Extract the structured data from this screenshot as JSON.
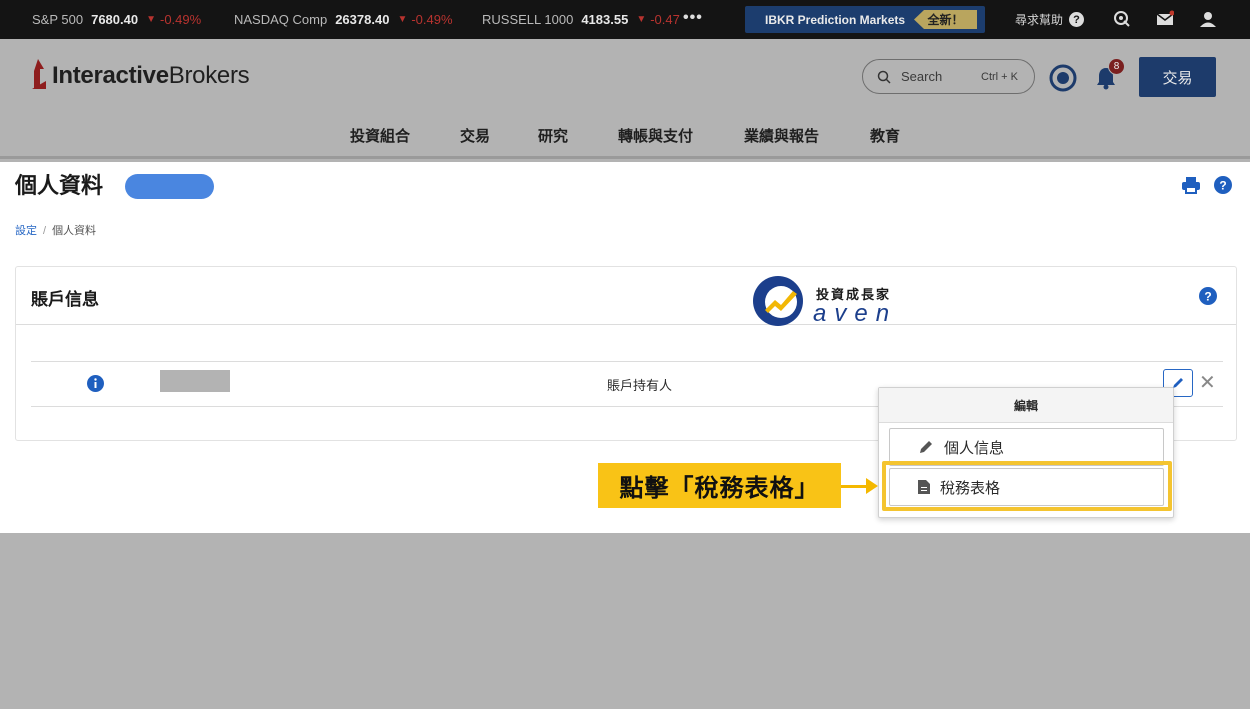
{
  "ticker": [
    {
      "name": "S&P 500",
      "value": "7680.40",
      "change": "-0.49%"
    },
    {
      "name": "NASDAQ Comp",
      "value": "26378.40",
      "change": "-0.49%"
    },
    {
      "name": "RUSSELL 1000",
      "value": "4183.55",
      "change": "-0.47"
    }
  ],
  "prediction_markets": {
    "label": "IBKR Prediction Markets",
    "badge": "全新！"
  },
  "top_links": {
    "help": "尋求幫助"
  },
  "header": {
    "brand_bold": "Interactive",
    "brand_regular": "Brokers",
    "search_placeholder": "Search",
    "search_shortcut": "Ctrl + K",
    "notification_count": "8",
    "trade_button": "交易"
  },
  "nav": [
    "投資組合",
    "交易",
    "研究",
    "轉帳與支付",
    "業績與報告",
    "教育"
  ],
  "page": {
    "title": "個人資料",
    "breadcrumb": [
      "設定",
      "個人資料"
    ]
  },
  "panel": {
    "title": "賬戶信息",
    "watermark_title": "投資成長家",
    "watermark_sub": "aven",
    "row_role": "賬戶持有人"
  },
  "dropdown": {
    "header": "編輯",
    "items": [
      "個人信息",
      "稅務表格"
    ]
  },
  "callout": {
    "text": "點擊「稅務表格」"
  },
  "colors": {
    "accent": "#2767c4",
    "callout": "#f9c316",
    "trade": "#1d3b6b",
    "ticker_down": "#b8332f"
  }
}
